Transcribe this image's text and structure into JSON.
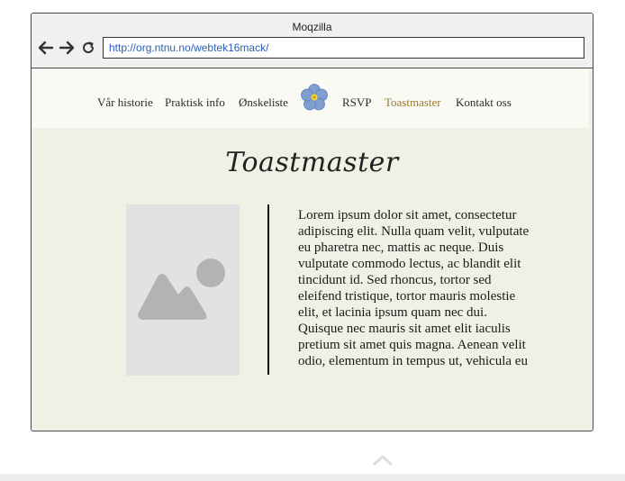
{
  "browser": {
    "title": "Moqzilla",
    "url": "http://org.ntnu.no/webtek16mack/",
    "icons": [
      "arrow-left-icon",
      "arrow-right-icon",
      "reload-icon"
    ]
  },
  "site_nav": {
    "items": [
      {
        "label": "Vår historie",
        "active": false
      },
      {
        "label": "Praktisk info",
        "active": false
      },
      {
        "label": "Ønskeliste",
        "active": false
      },
      {
        "label": "RSVP",
        "active": false
      },
      {
        "label": "Toastmaster",
        "active": true
      },
      {
        "label": "Kontakt oss",
        "active": false
      }
    ],
    "logo_icon": "forget-me-not-flower-icon",
    "active_color": "#9a7a2e"
  },
  "main": {
    "heading": "Toastmaster",
    "image_icon": "image-placeholder-icon",
    "body": "Lorem ipsum dolor sit amet, consectetur adipiscing elit. Nulla quam velit, vulputate eu pharetra nec, mattis ac neque. Duis vulputate commodo lectus, ac blandit elit tincidunt id. Sed rhoncus, tortor sed eleifend tristique, tortor mauris molestie elit, et lacinia ipsum quam nec dui. Quisque nec mauris sit amet elit iaculis pretium sit amet quis magna. Aenean velit odio, elementum in tempus ut, vehicula eu diam."
  },
  "colors": {
    "page_background": "#f1f0e5",
    "nav_background": "#fafaf4",
    "url_text": "#2a60b4"
  }
}
